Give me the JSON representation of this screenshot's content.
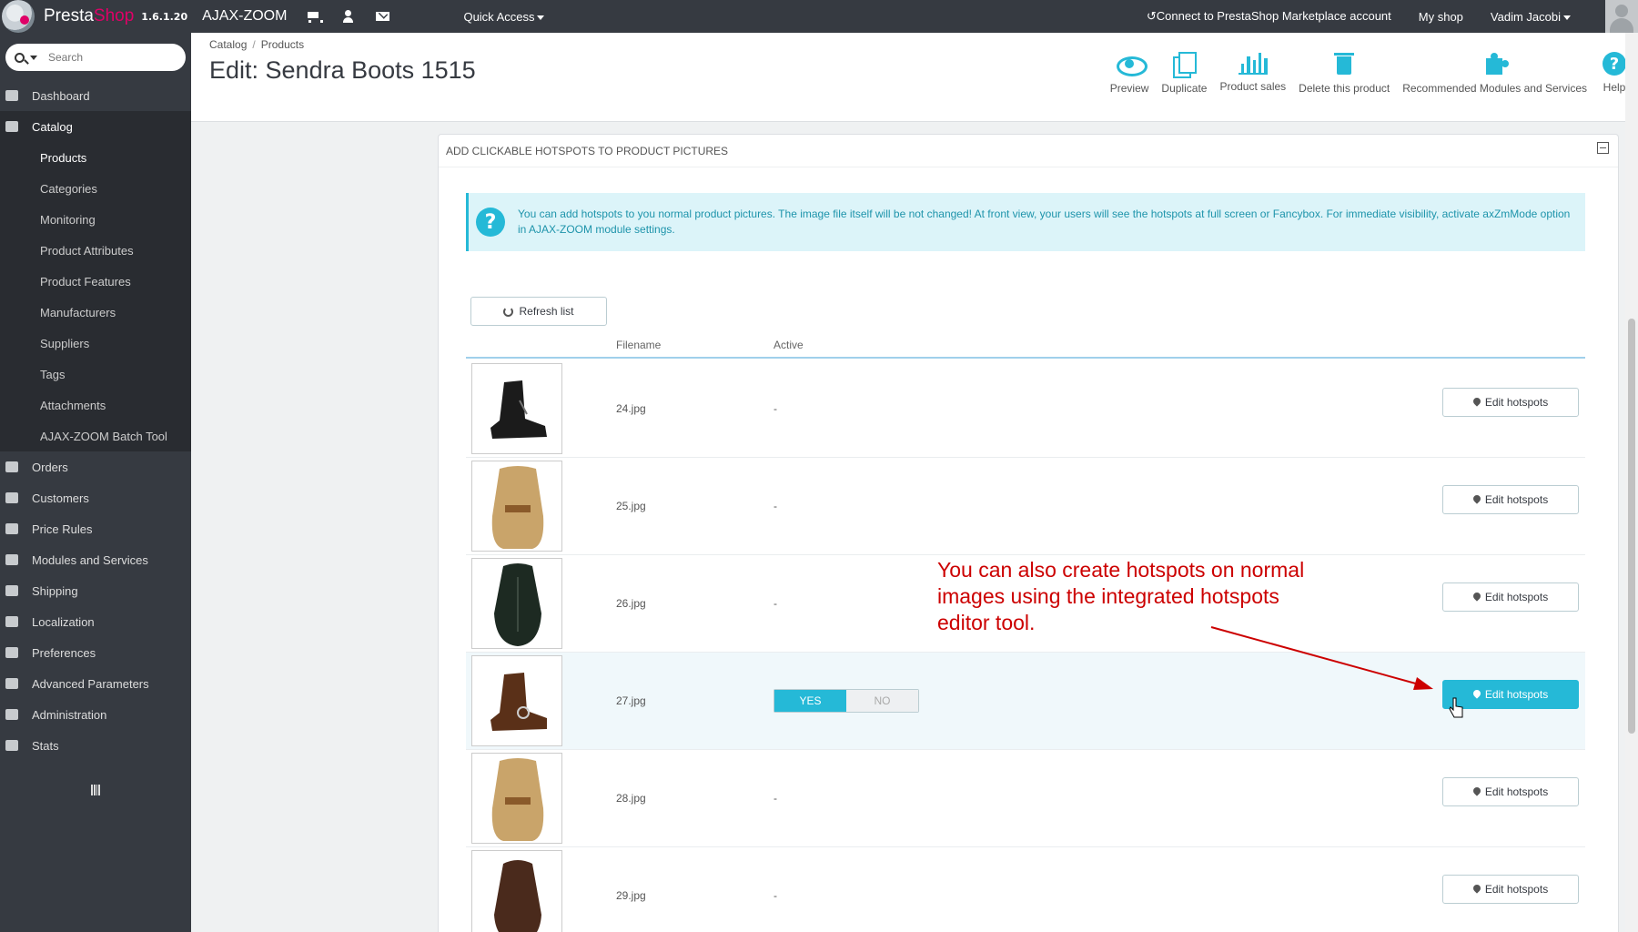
{
  "topbar": {
    "brand_a": "Presta",
    "brand_b": "Shop",
    "version": "1.6.1.20",
    "shop_name": "AJAX-ZOOM",
    "quick_access": "Quick Access",
    "marketplace": "Connect to PrestaShop Marketplace account",
    "my_shop": "My shop",
    "user": "Vadim Jacobi"
  },
  "search": {
    "placeholder": "Search"
  },
  "sidebar": {
    "items": [
      {
        "label": "Dashboard",
        "icon": "dashboard-icon"
      },
      {
        "label": "Catalog",
        "icon": "book-icon"
      },
      {
        "label": "Orders",
        "icon": "credit-card-icon"
      },
      {
        "label": "Customers",
        "icon": "users-icon"
      },
      {
        "label": "Price Rules",
        "icon": "tags-icon"
      },
      {
        "label": "Modules and Services",
        "icon": "puzzle-icon"
      },
      {
        "label": "Shipping",
        "icon": "truck-icon"
      },
      {
        "label": "Localization",
        "icon": "globe-icon"
      },
      {
        "label": "Preferences",
        "icon": "wrench-icon"
      },
      {
        "label": "Advanced Parameters",
        "icon": "cogs-icon"
      },
      {
        "label": "Administration",
        "icon": "cog-icon"
      },
      {
        "label": "Stats",
        "icon": "bar-chart-icon"
      }
    ],
    "catalog_sub": [
      "Products",
      "Categories",
      "Monitoring",
      "Product Attributes",
      "Product Features",
      "Manufacturers",
      "Suppliers",
      "Tags",
      "Attachments",
      "AJAX-ZOOM Batch Tool"
    ]
  },
  "breadcrumb": {
    "level1": "Catalog",
    "level2": "Products"
  },
  "page_title": "Edit: Sendra Boots 1515",
  "toolbar": {
    "preview": "Preview",
    "duplicate": "Duplicate",
    "sales": "Product sales",
    "delete": "Delete this product",
    "recommended": "Recommended Modules and Services",
    "help": "Help"
  },
  "panel": {
    "title": "ADD CLICKABLE HOTSPOTS TO PRODUCT PICTURES",
    "alert": "You can add hotspots to you normal product pictures. The image file itself will be not changed! At front view, your users will see the hotspots at full screen or Fancybox. For immediate visibility, activate axZmMode option in AJAX-ZOOM module settings.",
    "refresh": "Refresh list",
    "col_filename": "Filename",
    "col_active": "Active",
    "rows": [
      {
        "file": "24.jpg",
        "active": "-",
        "button": "Edit hotspots"
      },
      {
        "file": "25.jpg",
        "active": "-",
        "button": "Edit hotspots"
      },
      {
        "file": "26.jpg",
        "active": "-",
        "button": "Edit hotspots"
      },
      {
        "file": "27.jpg",
        "active": "YES",
        "yes": "YES",
        "no": "NO",
        "button": "Edit hotspots"
      },
      {
        "file": "28.jpg",
        "active": "-",
        "button": "Edit hotspots"
      },
      {
        "file": "29.jpg",
        "active": "-",
        "button": "Edit hotspots"
      }
    ]
  },
  "annotation": "You can also create hotspots on normal images using the integrated hotspots editor tool.",
  "colors": {
    "accent": "#25b9d7",
    "sidebar": "#363a41",
    "annotation": "#cc0000",
    "brand": "#df0067"
  }
}
